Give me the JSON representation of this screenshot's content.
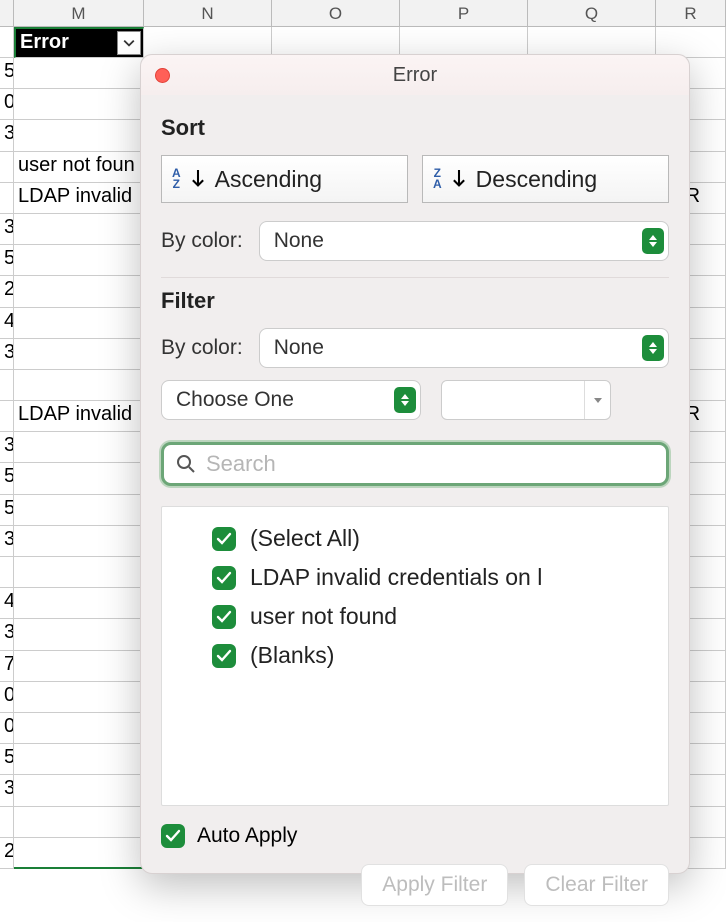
{
  "columns": [
    "M",
    "N",
    "O",
    "P",
    "Q",
    "R"
  ],
  "header_cell": {
    "label": "Error"
  },
  "rows": [
    {
      "L": "5",
      "M": ""
    },
    {
      "L": "0",
      "M": ""
    },
    {
      "L": "3",
      "M": ""
    },
    {
      "L": "",
      "M": "user not foun"
    },
    {
      "L": "",
      "M": "LDAP invalid"
    },
    {
      "L": "3",
      "M": ""
    },
    {
      "L": "5",
      "M": ""
    },
    {
      "L": "2",
      "M": ""
    },
    {
      "L": "4",
      "M": ""
    },
    {
      "L": "3",
      "M": ""
    },
    {
      "L": "",
      "M": ""
    },
    {
      "L": "",
      "M": "LDAP invalid"
    },
    {
      "L": "3",
      "M": ""
    },
    {
      "L": "5",
      "M": ""
    },
    {
      "L": "5",
      "M": ""
    },
    {
      "L": "3",
      "M": ""
    },
    {
      "L": "",
      "M": ""
    },
    {
      "L": "4",
      "M": ""
    },
    {
      "L": "3",
      "M": ""
    },
    {
      "L": "7",
      "M": ""
    },
    {
      "L": "0",
      "M": ""
    },
    {
      "L": "0",
      "M": ""
    },
    {
      "L": "5",
      "M": ""
    },
    {
      "L": "3",
      "M": ""
    },
    {
      "L": "",
      "M": ""
    },
    {
      "L": "2",
      "M": ""
    }
  ],
  "far_R_values": {
    "4": "alsR",
    "11": "alsR"
  },
  "dialog": {
    "title": "Error",
    "sort_heading": "Sort",
    "asc_label": "Ascending",
    "desc_label": "Descending",
    "by_color_label": "By color:",
    "none_label": "None",
    "filter_heading": "Filter",
    "choose_one": "Choose One",
    "search_placeholder": "Search",
    "values": [
      "(Select All)",
      "LDAP invalid credentials on l",
      "user not found",
      "(Blanks)"
    ],
    "auto_apply": "Auto Apply",
    "apply_filter": "Apply Filter",
    "clear_filter": "Clear Filter"
  }
}
